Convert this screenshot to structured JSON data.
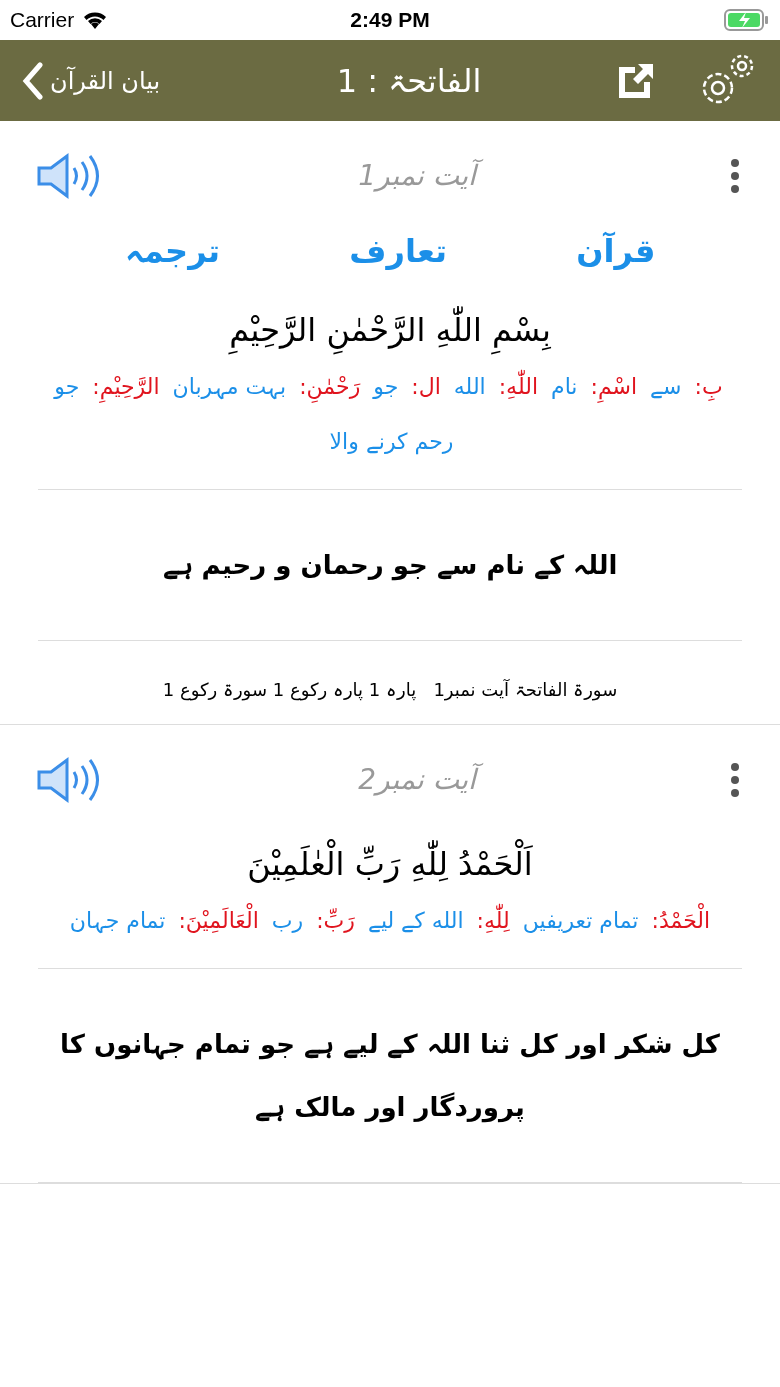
{
  "status_bar": {
    "carrier": "Carrier",
    "time": "2:49 PM"
  },
  "nav": {
    "back": "بیان القرآن",
    "title": "الفاتحۃ : 1"
  },
  "ayahs": [
    {
      "label": "آیت نمبر1",
      "tabs": [
        "قرآن",
        "تعارف",
        "ترجمہ"
      ],
      "arabic": "بِسْمِ اللّٰهِ الرَّحْمٰنِ الرَّحِيْمِ",
      "words": [
        {
          "text": "بِ:",
          "color": "#e0141e"
        },
        {
          "text": "سے",
          "color": "#1b8fe8"
        },
        {
          "text": "اسْمِ:",
          "color": "#e0141e"
        },
        {
          "text": "نام",
          "color": "#1b8fe8"
        },
        {
          "text": "اللّٰهِ:",
          "color": "#e0141e"
        },
        {
          "text": "الله",
          "color": "#1b8fe8"
        },
        {
          "text": "ال:",
          "color": "#e0141e"
        },
        {
          "text": "جو",
          "color": "#1b8fe8"
        },
        {
          "text": "رَحْمٰنِ:",
          "color": "#e0141e"
        },
        {
          "text": "بہت مہربان",
          "color": "#1b8fe8"
        },
        {
          "text": "الرَّحِيْمِ:",
          "color": "#e0141e"
        },
        {
          "text": "جو رحم کرنے والا",
          "color": "#1b8fe8"
        }
      ],
      "translation": "اللہ کے نام سے جو رحمان و رحیم ہے",
      "info": "سورۃ الفاتحۃ آیت نمبر1   پارہ 1 پارہ رکوع 1 سورۃ رکوع 1"
    },
    {
      "label": "آیت نمبر2",
      "arabic": "اَلْحَمْدُ لِلّٰهِ رَبِّ الْعٰلَمِيْنَ",
      "words": [
        {
          "text": "الْحَمْدُ:",
          "color": "#e0141e"
        },
        {
          "text": "تمام تعریفیں",
          "color": "#1b8fe8"
        },
        {
          "text": "لِلّٰهِ:",
          "color": "#e0141e"
        },
        {
          "text": "الله کے لیے",
          "color": "#1b8fe8"
        },
        {
          "text": "رَبِّ:",
          "color": "#e0141e"
        },
        {
          "text": "رب",
          "color": "#1b8fe8"
        },
        {
          "text": "الْعَالَمِيْنَ:",
          "color": "#e0141e"
        },
        {
          "text": "تمام جہان",
          "color": "#1b8fe8"
        }
      ],
      "translation": "کل شکر اور کل ثنا اللہ کے لیے ہے جو تمام جہانوں کا پروردگار اور مالک ہے"
    }
  ]
}
